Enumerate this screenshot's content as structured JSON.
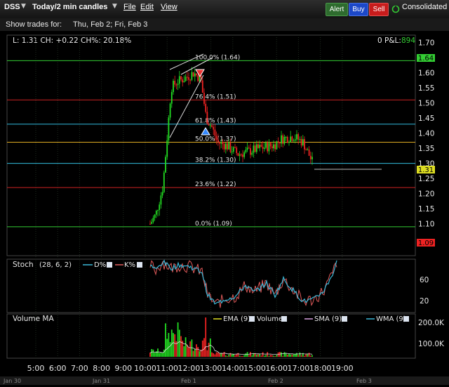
{
  "toolbar": {
    "symbol": "DSS",
    "timeframe": "Today/2 min candles",
    "menu_file": "File",
    "menu_edit": "Edit",
    "menu_view": "View",
    "alert_label": "Alert",
    "buy_label": "Buy",
    "sell_label": "Sell",
    "consolidated_label": "Consolidated"
  },
  "trades_bar": {
    "prefix": "Show trades for:",
    "dates": "Thu, Feb 2; Fri, Feb 3"
  },
  "status": {
    "quote": "L: 1.31 CH: +0.22 CH%: 20.18%",
    "pnl_label": "0 P&L:",
    "pnl_value": "894"
  },
  "price_panel": {
    "y_ticks": [
      "1.70",
      "1.65",
      "1.60",
      "1.55",
      "1.50",
      "1.45",
      "1.40",
      "1.35",
      "1.30",
      "1.25",
      "1.20",
      "1.15",
      "1.10"
    ],
    "last_price": "1.31",
    "high_badge": "1.64",
    "low_badge": "1.09",
    "fib_levels": [
      {
        "label": "100.0% (1.64)",
        "price": 1.64,
        "color": "#3c3"
      },
      {
        "label": "76.4% (1.51)",
        "price": 1.51,
        "color": "#c22"
      },
      {
        "label": "61.8% (1.43)",
        "price": 1.43,
        "color": "#3bd"
      },
      {
        "label": "50.0% (1.37)",
        "price": 1.37,
        "color": "#da2"
      },
      {
        "label": "38.2% (1.30)",
        "price": 1.3,
        "color": "#3bd"
      },
      {
        "label": "23.6% (1.22)",
        "price": 1.22,
        "color": "#c22"
      },
      {
        "label": "0.0% (1.09)",
        "price": 1.09,
        "color": "#3c3"
      }
    ]
  },
  "stoch_panel": {
    "title": "Stoch",
    "params": "(28, 6, 2)",
    "d_label": "D%",
    "k_label": "K%",
    "y_ticks": [
      "60",
      "20"
    ]
  },
  "volume_panel": {
    "title": "Volume MA",
    "ema_label": "EMA (9)",
    "volume_label": "Volume",
    "sma_label": "SMA (9)",
    "wma_label": "WMA (9)",
    "y_ticks": [
      "200.0K",
      "100.0K"
    ]
  },
  "time_axis": {
    "labels": [
      "5:00",
      "6:00",
      "7:00",
      "8:00",
      "9:00",
      "10:00",
      "11:00",
      "12:00",
      "13:00",
      "14:00",
      "15:00",
      "16:00",
      "17:00",
      "18:00",
      "19:00"
    ],
    "date_labels": [
      "Jan 30",
      "Jan 31",
      "Feb 1",
      "Feb 2",
      "Feb 3"
    ]
  },
  "colors": {
    "up": "#22dd22",
    "down": "#ee2222",
    "d_line": "#3ab8d8",
    "k_line": "#e05a5a",
    "toolbar_alert": "#3a7a3a",
    "toolbar_buy": "#1c48c8",
    "toolbar_sell": "#c81c1c"
  }
}
